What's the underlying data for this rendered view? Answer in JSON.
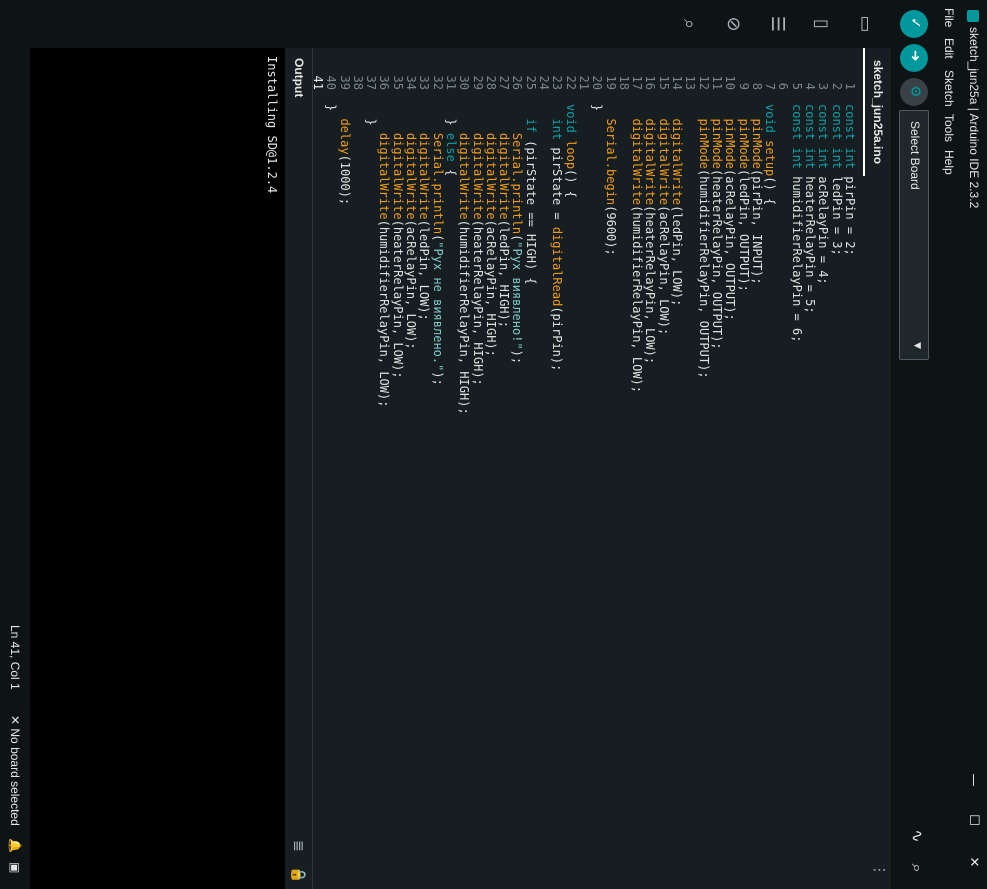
{
  "window": {
    "title": "sketch_jun25a | Arduino IDE 2.3.2",
    "minimize": "—",
    "maximize": "☐",
    "close": "✕"
  },
  "menu": [
    "File",
    "Edit",
    "Sketch",
    "Tools",
    "Help"
  ],
  "toolbar": {
    "verify_icon": "✓",
    "upload_icon": "➜",
    "debug_icon": "⚙",
    "board_select": "Select Board",
    "board_caret": "▼",
    "plotter_icon": "∿",
    "monitor_icon": "⌕"
  },
  "sidebar": {
    "icons": [
      "▭",
      "▯",
      "☰",
      "⊘",
      "⌕"
    ]
  },
  "tab": {
    "label": "sketch_jun25a.ino",
    "more": "⋮"
  },
  "editor": {
    "current_line": 41,
    "lines": [
      "const int pirPin = 2;",
      "const int ledPin = 3;",
      "const int acRelayPin = 4;",
      "const int heaterRelayPin = 5;",
      "const int humidifierRelayPin = 6;",
      "",
      "void setup() {",
      "  pinMode(pirPin, INPUT);",
      "  pinMode(ledPin, OUTPUT);",
      "  pinMode(acRelayPin, OUTPUT);",
      "  pinMode(heaterRelayPin, OUTPUT);",
      "  pinMode(humidifierRelayPin, OUTPUT);",
      "",
      "  digitalWrite(ledPin, LOW);",
      "  digitalWrite(acRelayPin, LOW);",
      "  digitalWrite(heaterRelayPin, LOW);",
      "  digitalWrite(humidifierRelayPin, LOW);",
      "",
      "  Serial.begin(9600);",
      "}",
      "",
      "void loop() {",
      "  int pirState = digitalRead(pirPin);",
      "",
      "  if (pirState == HIGH) {",
      "    Serial.println(\"Рух виявлено!\");",
      "    digitalWrite(ledPin, HIGH);",
      "    digitalWrite(acRelayPin, HIGH);",
      "    digitalWrite(heaterRelayPin, HIGH);",
      "    digitalWrite(humidifierRelayPin, HIGH);",
      "  } else {",
      "    Serial.println(\"Рух не виявлено.\");",
      "    digitalWrite(ledPin, LOW);",
      "    digitalWrite(acRelayPin, LOW);",
      "    digitalWrite(heaterRelayPin, LOW);",
      "    digitalWrite(humidifierRelayPin, LOW);",
      "  }",
      "",
      "  delay(1000);",
      "}",
      ""
    ]
  },
  "output": {
    "title": "Output",
    "lines": [
      "Installing SD@1.2.4"
    ],
    "clear_icon": "≣",
    "lock_icon": "🔒"
  },
  "status": {
    "position": "Ln 41, Col 1",
    "board": "✕ No board selected",
    "notif_icon": "🔔",
    "panel_icon": "▣"
  }
}
